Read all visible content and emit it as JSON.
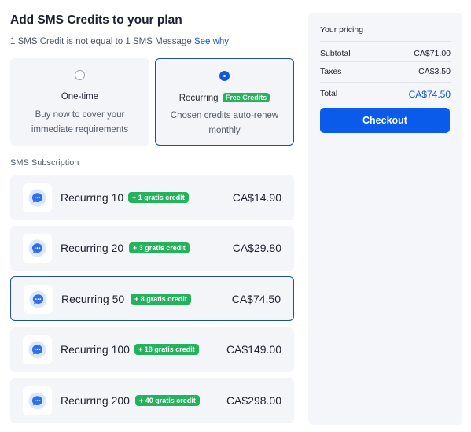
{
  "title": "Add SMS Credits to your plan",
  "note": {
    "text": "1 SMS Credit is not equal to 1 SMS Message",
    "link": "See why"
  },
  "options": {
    "onetime": {
      "label": "One-time",
      "desc": "Buy now to cover your immediate requirements",
      "selected": false
    },
    "recurring": {
      "label": "Recurring",
      "badge": "Free Credits",
      "desc": "Chosen credits auto-renew monthly",
      "selected": true
    }
  },
  "section_label": "SMS Subscription",
  "plans": [
    {
      "name": "Recurring 10",
      "badge": "+ 1 gratis credit",
      "price": "CA$14.90",
      "selected": false,
      "icon": "message-bubble-icon"
    },
    {
      "name": "Recurring 20",
      "badge": "+ 3 gratis credit",
      "price": "CA$29.80",
      "selected": false,
      "icon": "message-bubble-icon"
    },
    {
      "name": "Recurring 50",
      "badge": "+ 8 gratis credit",
      "price": "CA$74.50",
      "selected": true,
      "icon": "message-bubble-icon"
    },
    {
      "name": "Recurring 100",
      "badge": "+ 18 gratis credit",
      "price": "CA$149.00",
      "selected": false,
      "icon": "message-bubble-icon"
    },
    {
      "name": "Recurring 200",
      "badge": "+ 40 gratis credit",
      "price": "CA$298.00",
      "selected": false,
      "icon": "message-bubble-icon"
    }
  ],
  "pricing": {
    "title": "Your pricing",
    "subtotal_label": "Subtotal",
    "subtotal": "CA$71.00",
    "taxes_label": "Taxes",
    "taxes": "CA$3.50",
    "total_label": "Total",
    "total": "CA$74.50",
    "checkout_label": "Checkout"
  },
  "colors": {
    "accent": "#0a5bea",
    "badge_green": "#24b35c",
    "selected_border": "#1f4e9a"
  }
}
